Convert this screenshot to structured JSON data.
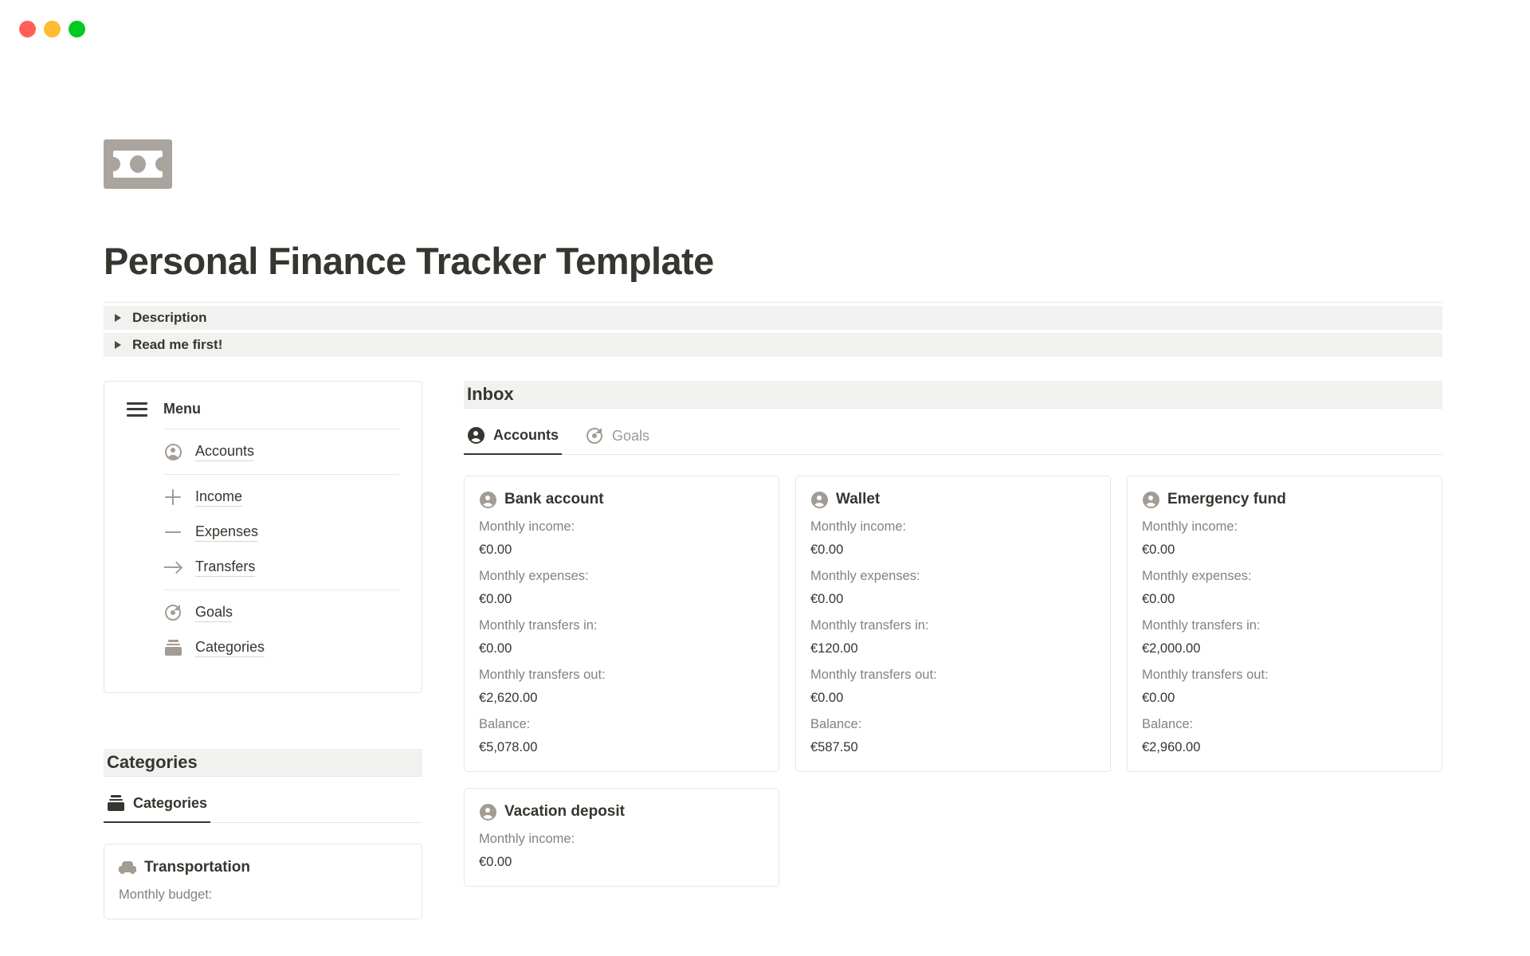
{
  "window": {
    "traffic_lights": [
      "close",
      "minimize",
      "maximize"
    ],
    "colors": {
      "close": "#ff5f57",
      "minimize": "#febc2e",
      "maximize": "#00c91f"
    }
  },
  "page": {
    "icon": "banknote-icon",
    "title": "Personal Finance Tracker Template"
  },
  "toggles": [
    {
      "label": "Description",
      "icon": "triangle-right-icon"
    },
    {
      "label": "Read me first!",
      "icon": "triangle-right-icon"
    }
  ],
  "menu": {
    "icon": "hamburger-icon",
    "title": "Menu",
    "groups": [
      {
        "items": [
          {
            "label": "Accounts",
            "icon": "person-circle-icon"
          }
        ]
      },
      {
        "items": [
          {
            "label": "Income",
            "icon": "plus-icon"
          },
          {
            "label": "Expenses",
            "icon": "minus-icon"
          },
          {
            "label": "Transfers",
            "icon": "arrow-right-icon"
          }
        ]
      },
      {
        "items": [
          {
            "label": "Goals",
            "icon": "target-icon"
          },
          {
            "label": "Categories",
            "icon": "stack-icon"
          }
        ]
      }
    ]
  },
  "categories_section": {
    "heading": "Categories",
    "tabs": [
      {
        "label": "Categories",
        "icon": "stack-icon",
        "active": true
      }
    ],
    "cards": [
      {
        "title": "Transportation",
        "icon": "car-icon",
        "rows": [
          {
            "label": "Monthly budget:",
            "value": ""
          }
        ]
      }
    ]
  },
  "inbox_section": {
    "heading": "Inbox",
    "tabs": [
      {
        "label": "Accounts",
        "icon": "person-circle-icon",
        "active": true
      },
      {
        "label": "Goals",
        "icon": "target-icon",
        "active": false
      }
    ],
    "cards": [
      {
        "title": "Bank account",
        "icon": "person-circle-icon",
        "rows": [
          {
            "label": "Monthly income:",
            "value": "€0.00"
          },
          {
            "label": "Monthly expenses:",
            "value": "€0.00"
          },
          {
            "label": "Monthly transfers in:",
            "value": "€0.00"
          },
          {
            "label": "Monthly transfers out:",
            "value": "€2,620.00"
          },
          {
            "label": "Balance:",
            "value": "€5,078.00"
          }
        ]
      },
      {
        "title": "Wallet",
        "icon": "person-circle-icon",
        "rows": [
          {
            "label": "Monthly income:",
            "value": "€0.00"
          },
          {
            "label": "Monthly expenses:",
            "value": "€0.00"
          },
          {
            "label": "Monthly transfers in:",
            "value": "€120.00"
          },
          {
            "label": "Monthly transfers out:",
            "value": "€0.00"
          },
          {
            "label": "Balance:",
            "value": "€587.50"
          }
        ]
      },
      {
        "title": "Emergency fund",
        "icon": "person-circle-icon",
        "rows": [
          {
            "label": "Monthly income:",
            "value": "€0.00"
          },
          {
            "label": "Monthly expenses:",
            "value": "€0.00"
          },
          {
            "label": "Monthly transfers in:",
            "value": "€2,000.00"
          },
          {
            "label": "Monthly transfers out:",
            "value": "€0.00"
          },
          {
            "label": "Balance:",
            "value": "€2,960.00"
          }
        ]
      },
      {
        "title": "Vacation deposit",
        "icon": "person-circle-icon",
        "rows": [
          {
            "label": "Monthly income:",
            "value": "€0.00"
          }
        ]
      }
    ]
  }
}
